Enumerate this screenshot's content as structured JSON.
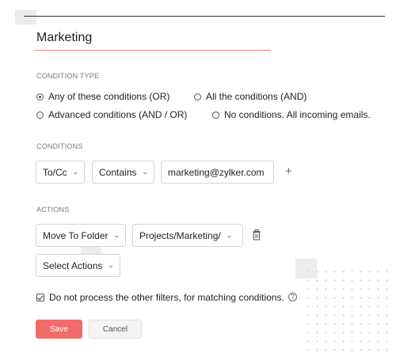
{
  "filter": {
    "name": "Marketing"
  },
  "condition_type": {
    "label": "CONDITION TYPE",
    "options": [
      {
        "label": "Any of these conditions (OR)",
        "selected": true
      },
      {
        "label": "All the conditions (AND)",
        "selected": false
      },
      {
        "label": "Advanced conditions (AND / OR)",
        "selected": false
      },
      {
        "label": "No conditions. All incoming emails.",
        "selected": false
      }
    ]
  },
  "conditions": {
    "label": "CONDITIONS",
    "field": "To/Cc",
    "operator": "Contains",
    "value": "marketing@zylker.com",
    "add_symbol": "+"
  },
  "actions": {
    "label": "ACTIONS",
    "action": "Move To Folder",
    "folder": "Projects/Marketing/",
    "select_placeholder": "Select Actions"
  },
  "options": {
    "stop_processing_label": "Do not process the other filters, for matching conditions.",
    "stop_processing_checked": true,
    "help_symbol": "?"
  },
  "buttons": {
    "save": "Save",
    "cancel": "Cancel"
  },
  "colors": {
    "accent": "#f26b6b",
    "underline": "#f07a7a"
  },
  "icons": {
    "chevron": "chevron-down-icon",
    "delete": "trash-icon",
    "help": "help-icon",
    "add": "plus-icon"
  }
}
